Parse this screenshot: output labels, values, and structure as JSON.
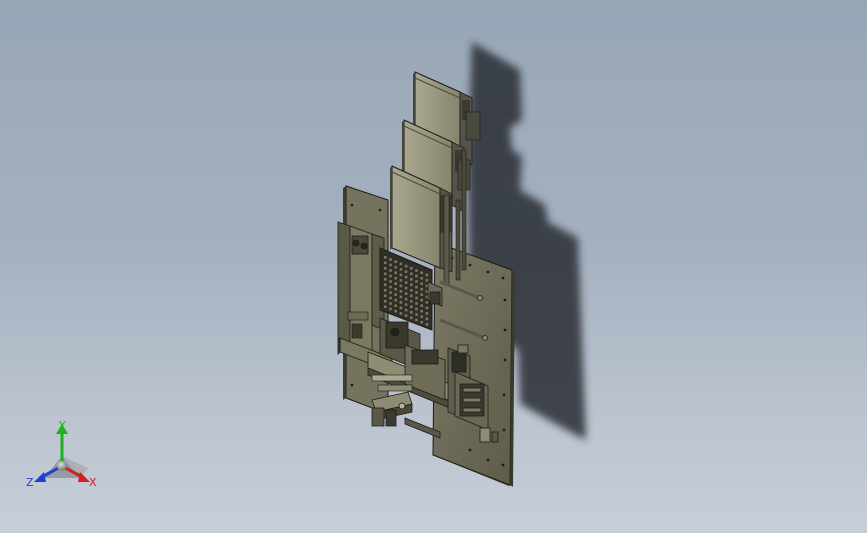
{
  "viewport": {
    "background_top": "#97a6b6",
    "background_bottom": "#c7ced9"
  },
  "model": {
    "body_color": "#6c6a56",
    "edge_color": "#1c1c16",
    "light_face": "#9a9880",
    "shadow_color": "#2e3238"
  },
  "triad": {
    "x_label": "X",
    "y_label": "Y",
    "z_label": "Z",
    "x_color": "#d42020",
    "y_color": "#20b020",
    "z_color": "#2040d0"
  }
}
